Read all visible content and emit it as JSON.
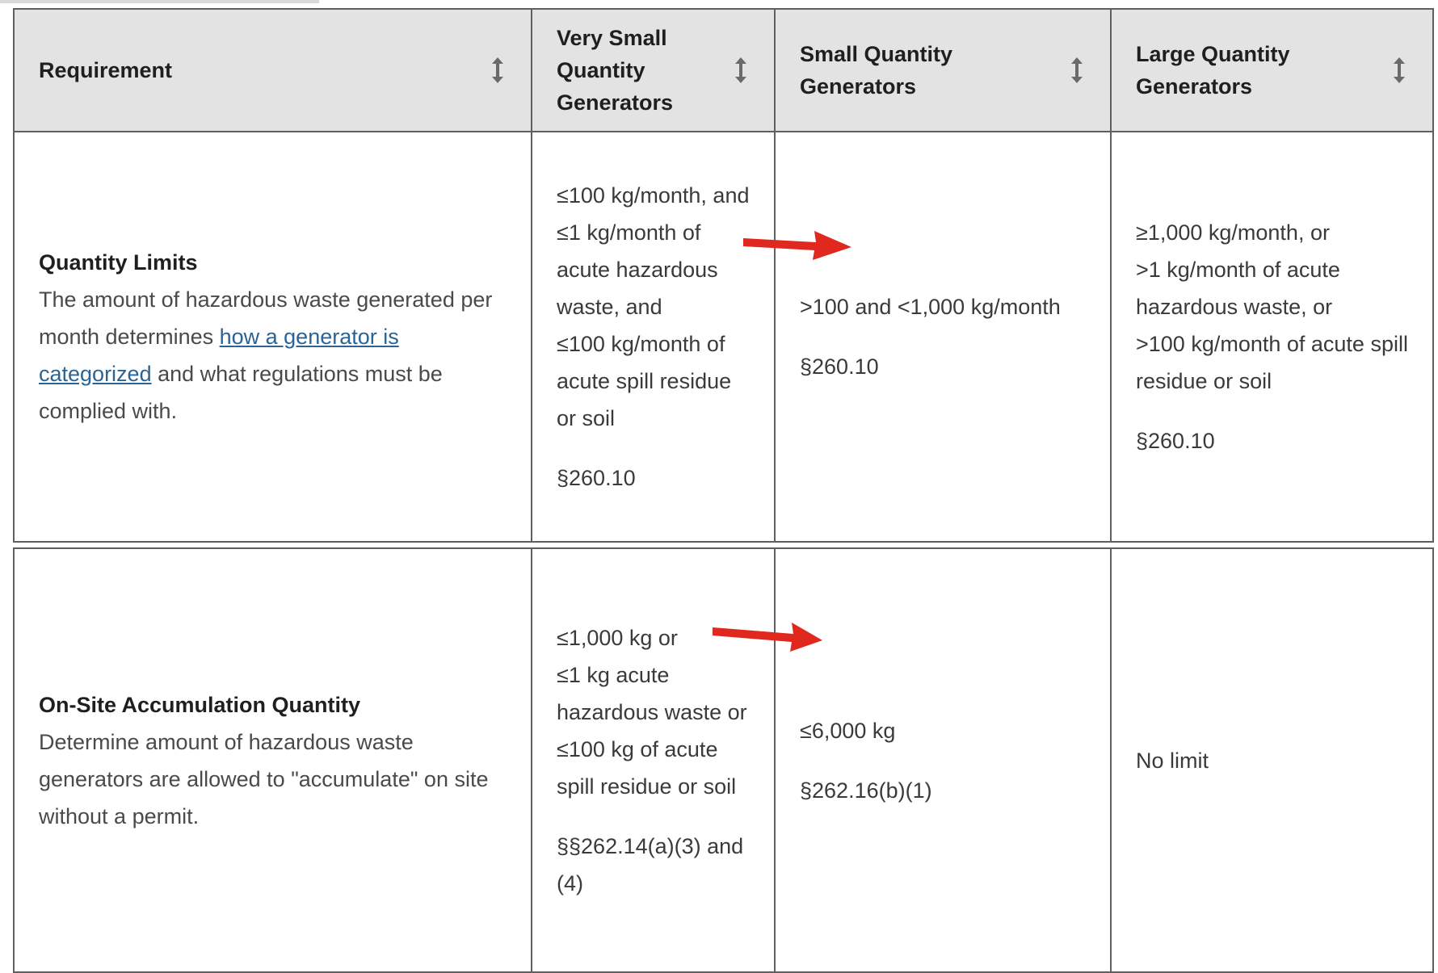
{
  "header": {
    "requirement": "Requirement",
    "vsqg": "Very Small Quantity Generators",
    "sqg": "Small Quantity Generators",
    "lqg": "Large Quantity Generators"
  },
  "rows": [
    {
      "title": "Quantity Limits",
      "desc_before": "The amount of hazardous waste generated per month determines ",
      "desc_link": "how a generator is categorized",
      "desc_after": " and what regulations must be complied with.",
      "vsqg_lines": [
        "≤100 kg/month, and",
        "≤1 kg/month of acute hazardous waste, and",
        "≤100 kg/month of acute spill residue or soil"
      ],
      "vsqg_cite": "§260.10",
      "sqg_value": ">100 and <1,000 kg/month",
      "sqg_cite": "§260.10",
      "lqg_lines": [
        "≥1,000 kg/month, or",
        ">1 kg/month of acute hazardous waste, or",
        ">100 kg/month of acute spill residue or soil"
      ],
      "lqg_cite": "§260.10"
    },
    {
      "title": "On-Site Accumulation Quantity",
      "desc": "Determine amount of hazardous waste generators are allowed to \"accumulate\" on site without a permit.",
      "vsqg_lines": [
        "≤1,000 kg or",
        "≤1 kg acute hazardous waste or",
        "≤100 kg of acute spill residue or soil"
      ],
      "vsqg_cite": "§§262.14(a)(3) and (4)",
      "sqg_value": "≤6,000 kg",
      "sqg_cite": "§262.16(b)(1)",
      "lqg_value": "No limit"
    }
  ],
  "icons": {
    "sort": "sort-arrows-icon",
    "annotation": "red-arrow-icon"
  },
  "colors": {
    "header_bg": "#e3e3e3",
    "border": "#5f5f5f",
    "link": "#2a6496",
    "annotation_arrow": "#e0281e"
  }
}
